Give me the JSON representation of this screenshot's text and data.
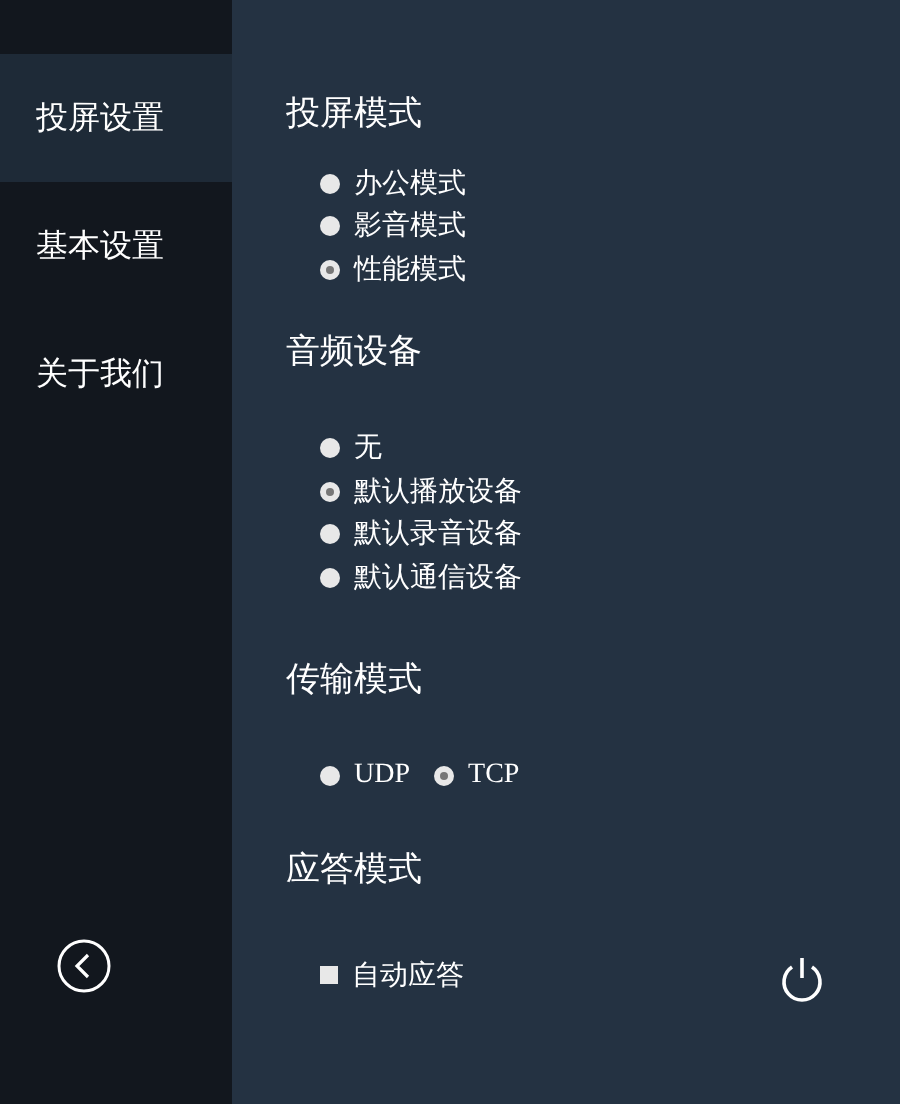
{
  "sidebar": {
    "items": [
      {
        "label": "投屏设置",
        "selected": true
      },
      {
        "label": "基本设置",
        "selected": false
      },
      {
        "label": "关于我们",
        "selected": false
      }
    ]
  },
  "sections": [
    {
      "title": "投屏模式",
      "inline": false,
      "options": [
        {
          "kind": "radio",
          "label": "办公模式",
          "selected": false
        },
        {
          "kind": "radio",
          "label": "影音模式",
          "selected": false
        },
        {
          "kind": "radio",
          "label": "性能模式",
          "selected": true
        }
      ]
    },
    {
      "title": "音频设备",
      "inline": false,
      "options": [
        {
          "kind": "radio",
          "label": "无",
          "selected": false
        },
        {
          "kind": "radio",
          "label": "默认播放设备",
          "selected": true
        },
        {
          "kind": "radio",
          "label": "默认录音设备",
          "selected": false
        },
        {
          "kind": "radio",
          "label": "默认通信设备",
          "selected": false
        }
      ]
    },
    {
      "title": "传输模式",
      "inline": true,
      "options": [
        {
          "kind": "radio",
          "label": "UDP",
          "selected": false
        },
        {
          "kind": "radio",
          "label": "TCP",
          "selected": true
        }
      ]
    },
    {
      "title": "应答模式",
      "options": [
        {
          "kind": "checkbox",
          "label": "自动应答",
          "checked": false
        }
      ]
    }
  ]
}
